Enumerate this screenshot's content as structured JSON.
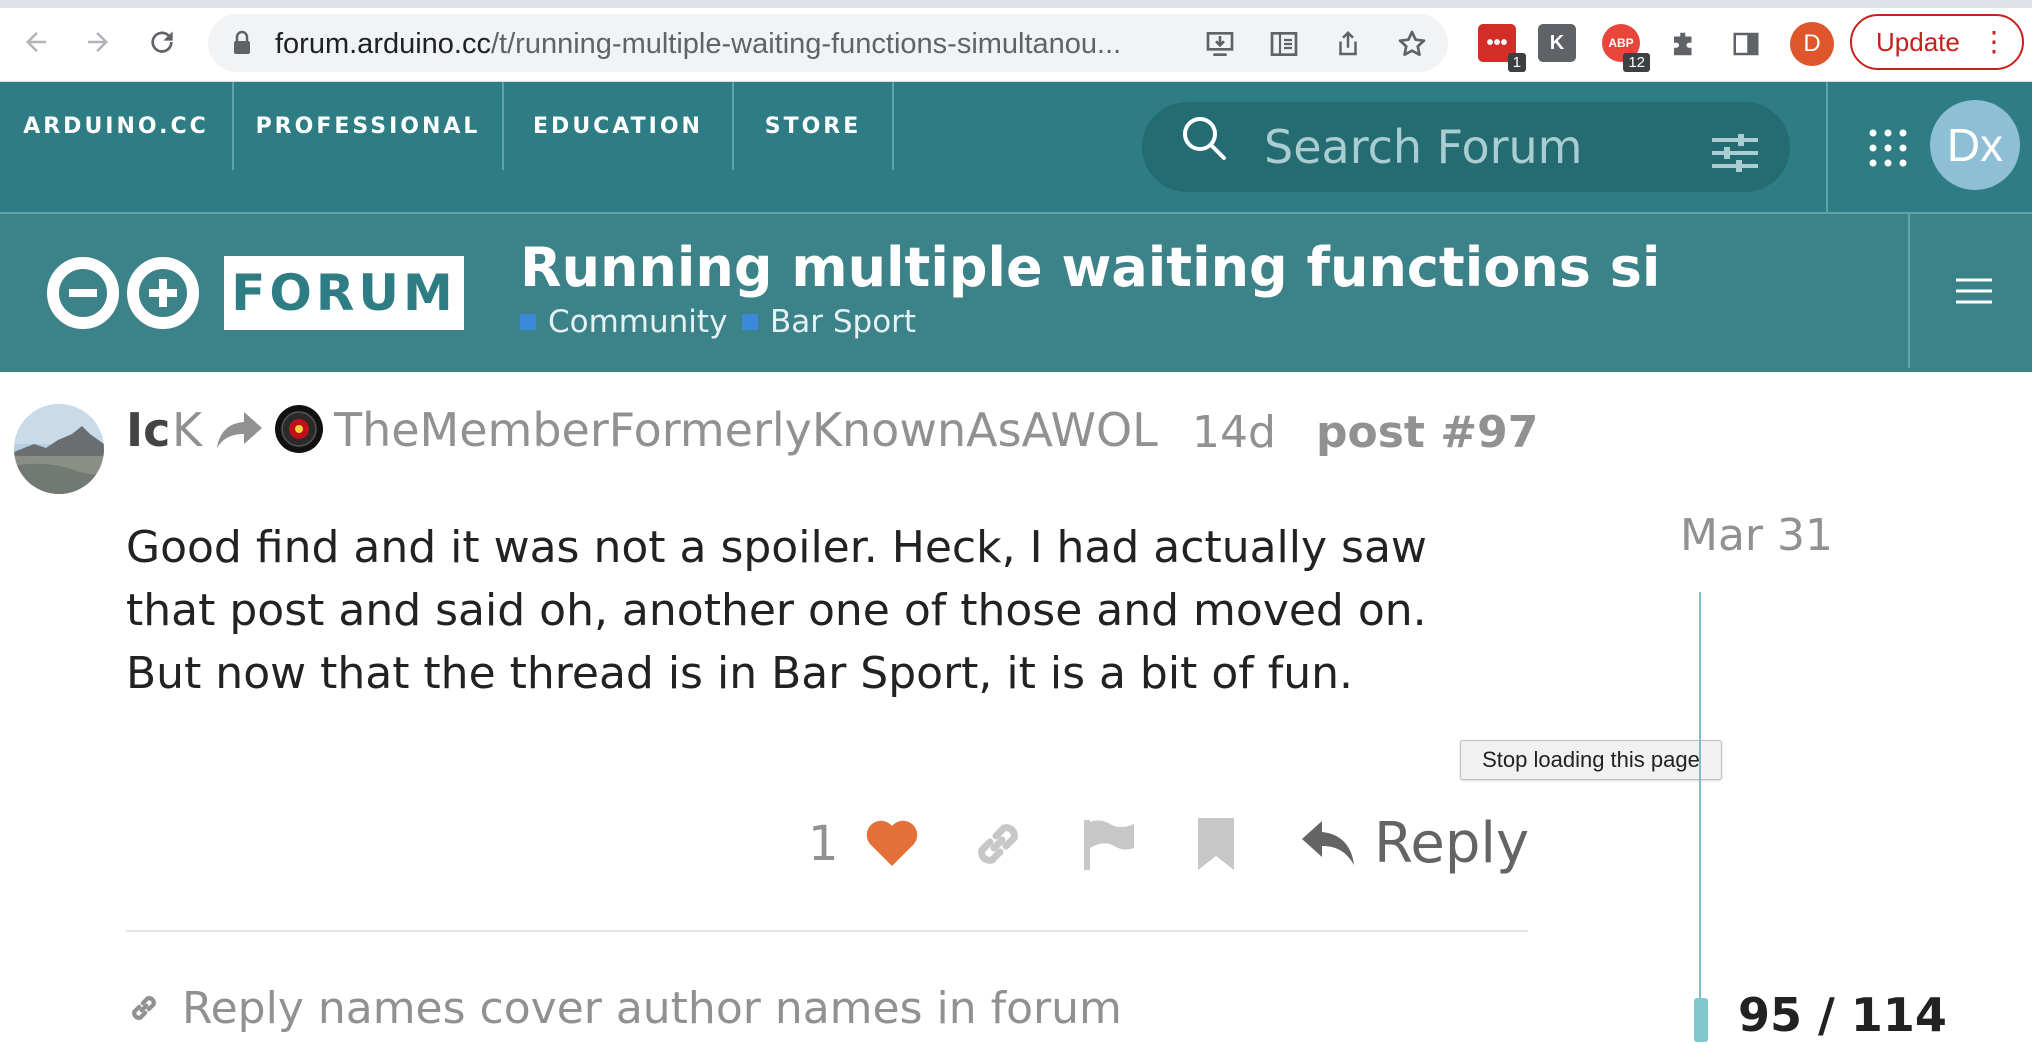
{
  "browser": {
    "url_host": "forum.arduino.cc",
    "url_path": "/t/running-multiple-waiting-functions-simultanou...",
    "extensions": [
      {
        "name": "lastpass",
        "badge": "1",
        "color": "#d32d27",
        "glyph": "•••"
      },
      {
        "name": "k-extension",
        "badge": "",
        "color": "#5f6368",
        "glyph": "K"
      },
      {
        "name": "adblock",
        "badge": "12",
        "color": "#e8453c",
        "glyph": "ABP"
      }
    ],
    "profile_initial": "D",
    "update_label": "Update"
  },
  "site_nav": {
    "links": [
      "ARDUINO.CC",
      "PROFESSIONAL",
      "EDUCATION",
      "STORE"
    ],
    "search_placeholder": "Search Forum",
    "avatar_initials": "Dx"
  },
  "forum_header": {
    "logo_text": "FORUM",
    "title": "Running multiple waiting functions sim...",
    "categories": [
      "Community",
      "Bar Sport"
    ]
  },
  "post": {
    "author_fragment_1": "Ic",
    "author_fragment_2": "K",
    "reply_to_user": "TheMemberFormerlyKnownAsAWOL",
    "age": "14d",
    "post_number": "post #97",
    "body": "Good find and it was not a spoiler. Heck, I had actually saw that post and said oh, another one of those and moved on. But now that the thread is in Bar Sport, it is a bit of fun.",
    "like_count": "1",
    "reply_label": "Reply",
    "linked_topic": "Reply names cover author names in forum"
  },
  "tooltip": "Stop loading this page",
  "timeline": {
    "start_date": "Mar 31",
    "progress": "95 / 114"
  },
  "colors": {
    "nav_bg": "#2f7d84",
    "header_bg": "#3b8289",
    "heart": "#e4703a",
    "category_square": "#3b8ad9"
  }
}
